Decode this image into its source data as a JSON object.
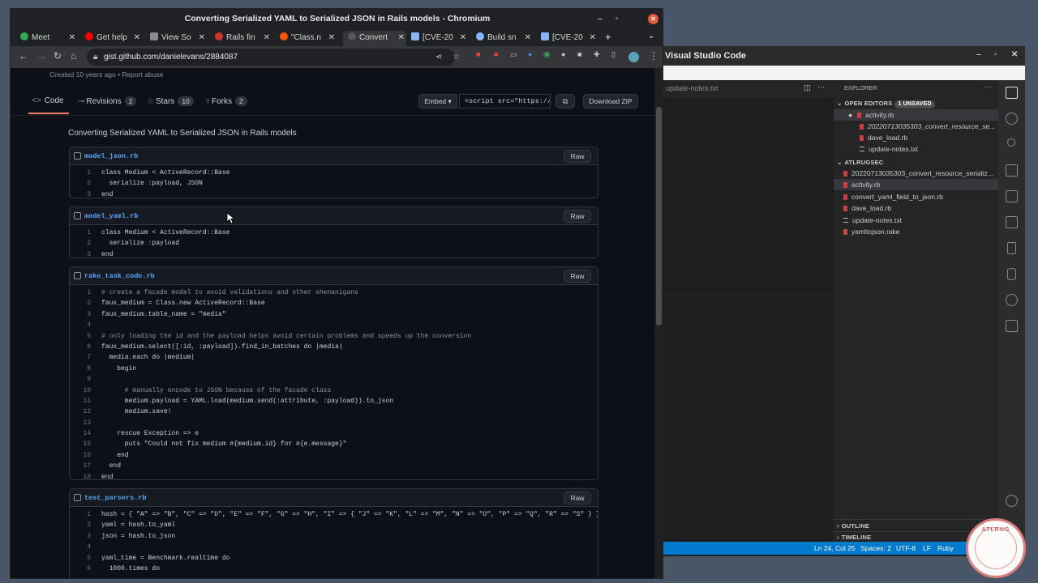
{
  "chromium": {
    "window_title": "Converting Serialized YAML to Serialized JSON in Rails models - Chromium",
    "tabs": [
      {
        "label": "Meet",
        "icon": "meet-icon",
        "color": "#34a853"
      },
      {
        "label": "Get help",
        "icon": "youtube-icon",
        "color": "#ff0000"
      },
      {
        "label": "View So",
        "icon": "gitlab-icon",
        "color": "#8a8a8a"
      },
      {
        "label": "Rails fin",
        "icon": "ruby-icon",
        "color": "#cc342d"
      },
      {
        "label": "\"Class.n",
        "icon": "brave-icon",
        "color": "#ff5500"
      },
      {
        "label": "Convert",
        "icon": "github-icon",
        "color": "#555555"
      },
      {
        "label": "[CVE-20",
        "icon": "jira-icon",
        "color": "#8ab4f8"
      },
      {
        "label": "Build sn",
        "icon": "link-icon",
        "color": "#8ab4f8"
      },
      {
        "label": "[CVE-20",
        "icon": "jira-icon",
        "color": "#8ab4f8"
      }
    ],
    "url": "gist.github.com/danielevans/2884087"
  },
  "gist": {
    "meta": "Created 10 years ago • Report abuse",
    "tab_code": "Code",
    "tab_revisions": "Revisions",
    "revisions_count": "2",
    "tab_stars": "Stars",
    "stars_count": "10",
    "tab_forks": "Forks",
    "forks_count": "2",
    "embed_label": "Embed ▾",
    "embed_value": "<script src=\"https://g",
    "download_label": "Download ZIP",
    "title": "Converting Serialized YAML to Serialized JSON in Rails models",
    "raw_label": "Raw",
    "files": [
      {
        "name": "model_json.rb",
        "lines": [
          "class Medium < ActiveRecord::Base",
          "  serialize :payload, JSON",
          "end"
        ]
      },
      {
        "name": "model_yaml.rb",
        "lines": [
          "class Medium < ActiveRecord::Base",
          "  serialize :payload",
          "end"
        ]
      },
      {
        "name": "rake_task_code.rb",
        "lines": [
          "# create a facade model to avoid validations and other shenanigans",
          "faux_medium = Class.new ActiveRecord::Base",
          "faux_medium.table_name = \"media\"",
          "",
          "# only loading the id and the payload helps avoid certain problems and speeds up the conversion",
          "faux_medium.select([:id, :payload]).find_in_batches do |media|",
          "  media.each do |medium|",
          "    begin",
          "",
          "      # manually encode to JSON because of the facade class",
          "      medium.payload = YAML.load(medium.send(:attribute, :payload)).to_json",
          "      medium.save!",
          "",
          "    rescue Exception => e",
          "      puts \"Could not fix medium #{medium.id} for #{e.message}\"",
          "    end",
          "  end",
          "end"
        ]
      },
      {
        "name": "test_parsers.rb",
        "lines": [
          "hash = { \"A\" => \"B\", \"C\" => \"D\", \"E\" => \"F\", \"G\" => \"H\", \"I\" => { \"J\" => \"K\", \"L\" => \"M\", \"N\" => \"O\", \"P\" => \"Q\", \"R\" => \"S\" } }",
          "yaml = hash.to_yaml",
          "json = hash.to_json",
          "",
          "yaml_time = Benchmark.realtime do",
          "  1000.times do"
        ]
      }
    ]
  },
  "vscode": {
    "window_title": "Visual Studio Code",
    "editor_tab": "update-notes.txt",
    "explorer_label": "EXPLORER",
    "open_editors_label": "OPEN EDITORS",
    "unsaved_badge": "1 UNSAVED",
    "open_editors": [
      {
        "name": "activity.rb",
        "type": "ruby",
        "modified": true
      },
      {
        "name": "20220713035303_convert_resource_se...",
        "type": "ruby",
        "italic": true
      },
      {
        "name": "dave_load.rb",
        "type": "ruby"
      },
      {
        "name": "update-notes.txt",
        "type": "text"
      }
    ],
    "folder_label": "ATLRUGSEC",
    "folder_files": [
      {
        "name": "20220713035303_convert_resource_serializ...",
        "type": "ruby"
      },
      {
        "name": "activity.rb",
        "type": "ruby",
        "selected": true
      },
      {
        "name": "convert_yaml_field_to_json.rb",
        "type": "ruby"
      },
      {
        "name": "dave_load.rb",
        "type": "ruby"
      },
      {
        "name": "update-notes.txt",
        "type": "text"
      },
      {
        "name": "yamltojson.rake",
        "type": "ruby"
      }
    ],
    "outline_label": "OUTLINE",
    "timeline_label": "TIMELINE",
    "status": {
      "position": "Ln 24, Col 25",
      "spaces": "Spaces: 2",
      "encoding": "UTF-8",
      "eol": "LF",
      "language": "Ruby"
    }
  },
  "logo": {
    "text": "ATLRUG"
  }
}
